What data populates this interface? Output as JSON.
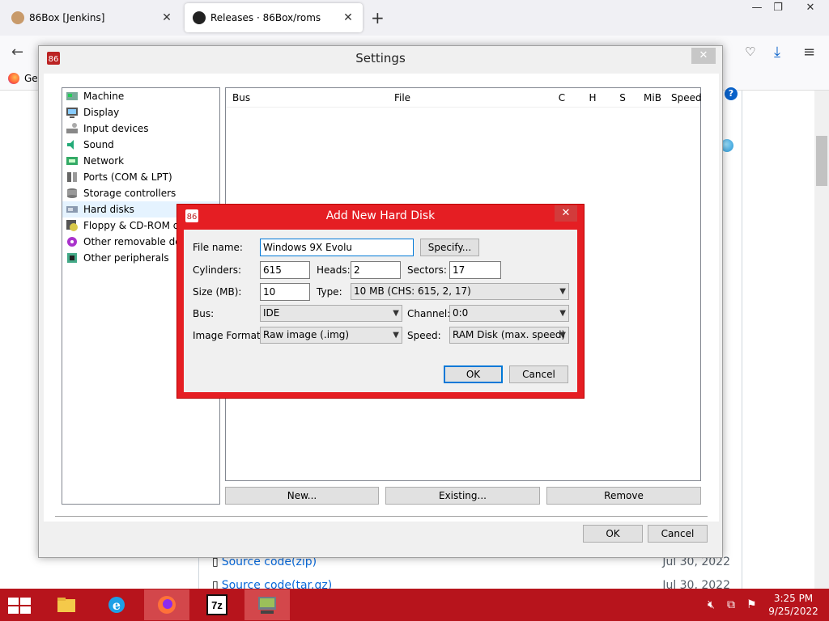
{
  "browser": {
    "tabs": [
      {
        "label": "86Box [Jenkins]",
        "icon": "jenkins-icon"
      },
      {
        "label": "Releases · 86Box/roms",
        "icon": "github-icon"
      }
    ],
    "bookmark": {
      "label": "Ge"
    }
  },
  "page": {
    "rows": [
      {
        "link": "Source code",
        "suffix": " (zip)",
        "date": "Jul 30, 2022"
      },
      {
        "link": "Source code",
        "suffix": " (tar.gz)",
        "date": "Jul 30, 2022"
      }
    ],
    "help_glyph": "?"
  },
  "settings": {
    "title": "Settings",
    "categories": [
      {
        "label": "Machine",
        "icon": "machine-icon"
      },
      {
        "label": "Display",
        "icon": "display-icon"
      },
      {
        "label": "Input devices",
        "icon": "input-devices-icon"
      },
      {
        "label": "Sound",
        "icon": "sound-icon"
      },
      {
        "label": "Network",
        "icon": "network-icon"
      },
      {
        "label": "Ports (COM & LPT)",
        "icon": "ports-icon"
      },
      {
        "label": "Storage controllers",
        "icon": "storage-controllers-icon"
      },
      {
        "label": "Hard disks",
        "icon": "hard-disks-icon",
        "selected": true
      },
      {
        "label": "Floppy & CD-ROM drives",
        "icon": "floppy-cdrom-icon"
      },
      {
        "label": "Other removable devices",
        "icon": "removable-devices-icon"
      },
      {
        "label": "Other peripherals",
        "icon": "peripherals-icon"
      }
    ],
    "columns": {
      "bus": "Bus",
      "file": "File",
      "c": "C",
      "h": "H",
      "s": "S",
      "mib": "MiB",
      "speed": "Speed"
    },
    "buttons": {
      "new": "New...",
      "existing": "Existing...",
      "remove": "Remove",
      "ok": "OK",
      "cancel": "Cancel"
    }
  },
  "dialog": {
    "title": "Add New Hard Disk",
    "labels": {
      "file_name": "File name:",
      "cylinders": "Cylinders:",
      "heads": "Heads:",
      "sectors": "Sectors:",
      "size": "Size (MB):",
      "type": "Type:",
      "bus": "Bus:",
      "channel": "Channel:",
      "image_format": "Image Format:",
      "speed": "Speed:"
    },
    "values": {
      "file_name": "Windows 9X Evolu",
      "cylinders": "615",
      "heads": "2",
      "sectors": "17",
      "size": "10",
      "type": "10 MB (CHS: 615, 2, 17)",
      "bus": "IDE",
      "channel": "0:0",
      "image_format": "Raw image (.img)",
      "speed": "RAM Disk (max. speed)"
    },
    "buttons": {
      "specify": "Specify...",
      "ok": "OK",
      "cancel": "Cancel"
    }
  },
  "taskbar": {
    "apps": [
      {
        "name": "file-explorer",
        "icon": "folder-icon"
      },
      {
        "name": "internet-explorer",
        "icon": "ie-icon"
      },
      {
        "name": "firefox",
        "icon": "firefox-icon",
        "active": true
      },
      {
        "name": "7zip",
        "icon": "7zip-icon",
        "label": "7z"
      },
      {
        "name": "86box",
        "icon": "86box-icon",
        "active": true
      }
    ],
    "time": "3:25 PM",
    "date": "9/25/2022"
  },
  "colors": {
    "taskbar": "#b7141c",
    "dialog_border": "#e51e23",
    "selection": "#e5f3ff",
    "link": "#0969da"
  }
}
